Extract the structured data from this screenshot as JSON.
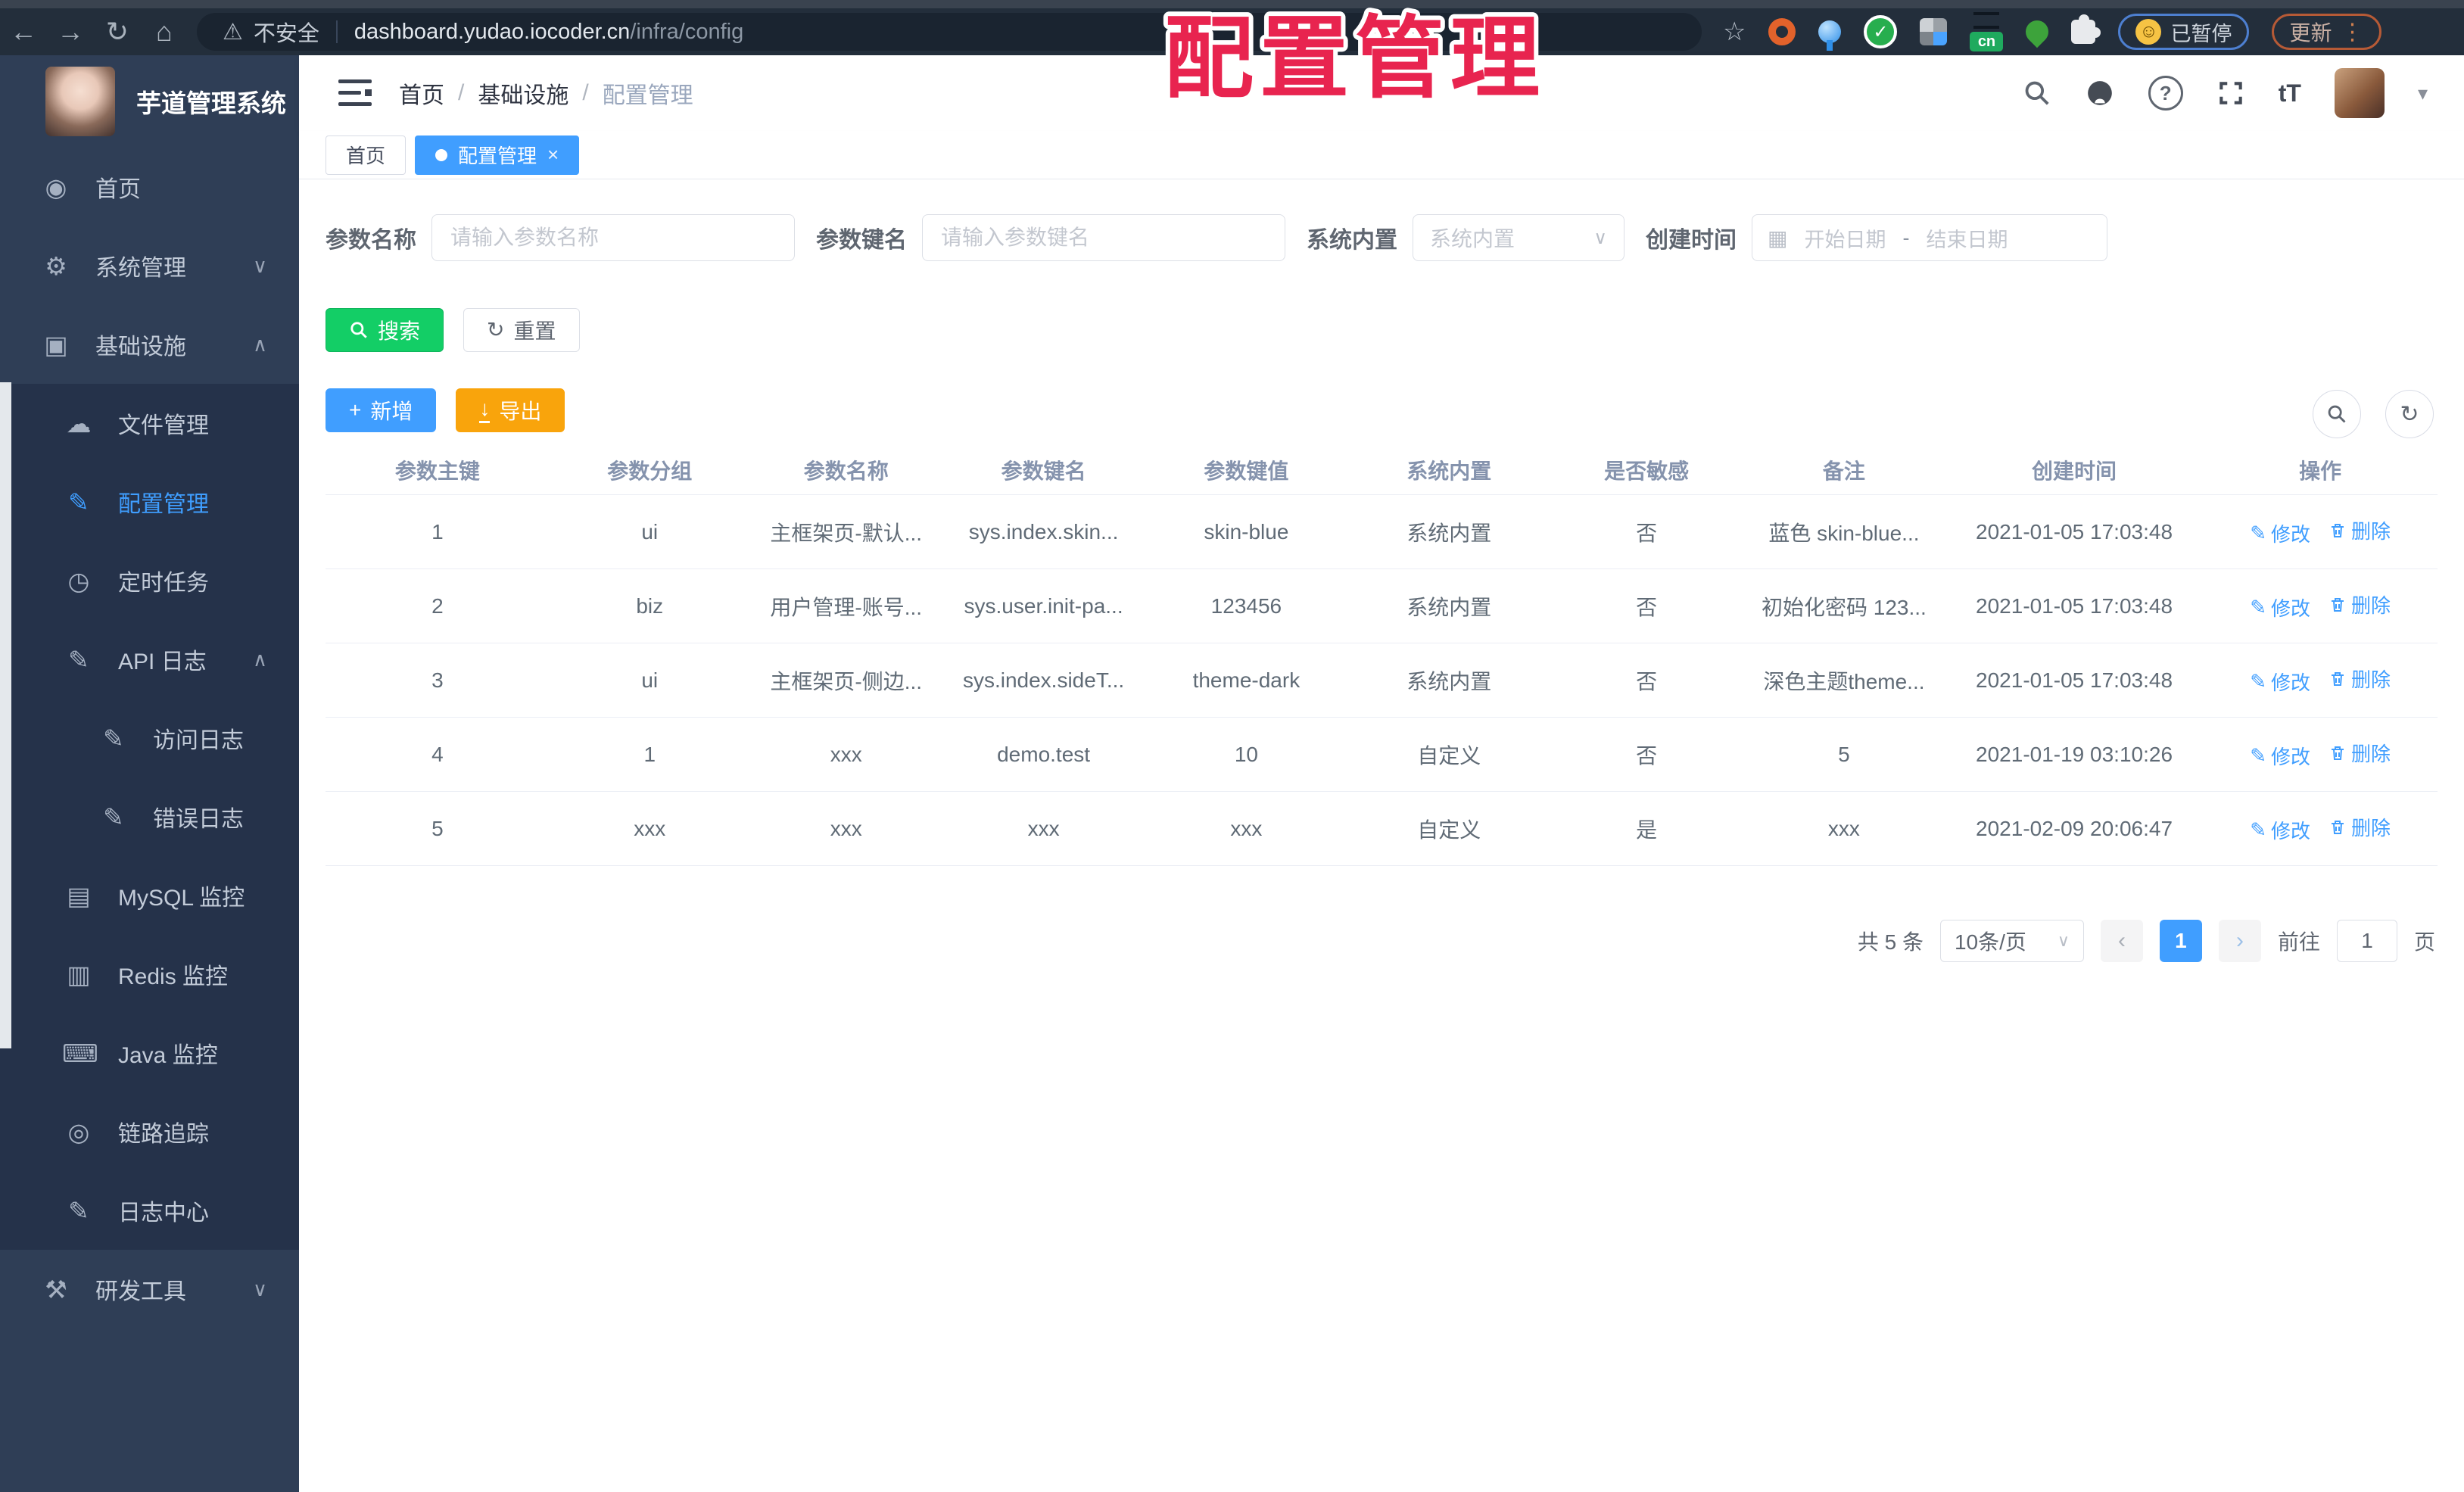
{
  "browser": {
    "security_label": "不安全",
    "url_host": "dashboard.yudao.iocoder.cn",
    "url_path": "/infra/config",
    "paused_badge": "已暂停",
    "update_button": "更新",
    "cn_badge_text": "cn"
  },
  "icons": {
    "back": "←",
    "forward": "→",
    "reload": "↻",
    "home": "⌂",
    "star": "☆",
    "warning": "⚠",
    "dots": "⋮",
    "smiley": "☺",
    "caret_down": "▾",
    "chevron_down": "∨",
    "chevron_up": "∧",
    "calendar": "▦",
    "refresh": "↻",
    "plus": "+",
    "download": "↓",
    "edit": "✎",
    "prev": "‹",
    "next": "›",
    "font_size": "tT",
    "help": "?"
  },
  "overlay": {
    "title": "配置管理",
    "color": "#e8244f"
  },
  "sidebar": {
    "app_title": "芋道管理系统",
    "items": [
      {
        "icon": "◉",
        "label": "首页"
      },
      {
        "icon": "⚙",
        "label": "系统管理",
        "chevron": "∨"
      },
      {
        "icon": "▣",
        "label": "基础设施",
        "chevron": "∧"
      },
      {
        "icon": "☁",
        "label": "文件管理"
      },
      {
        "icon": "✎",
        "label": "配置管理"
      },
      {
        "icon": "◷",
        "label": "定时任务"
      },
      {
        "icon": "✎",
        "label": "API 日志",
        "chevron": "∧"
      },
      {
        "icon": "✎",
        "label": "访问日志"
      },
      {
        "icon": "✎",
        "label": "错误日志"
      },
      {
        "icon": "▤",
        "label": "MySQL 监控"
      },
      {
        "icon": "▥",
        "label": "Redis 监控"
      },
      {
        "icon": "⌨",
        "label": "Java 监控"
      },
      {
        "icon": "◎",
        "label": "链路追踪"
      },
      {
        "icon": "✎",
        "label": "日志中心"
      },
      {
        "icon": "⚒",
        "label": "研发工具",
        "chevron": "∨"
      }
    ]
  },
  "header": {
    "breadcrumb": [
      "首页",
      "基础设施",
      "配置管理"
    ],
    "separator": "/"
  },
  "tabs": [
    {
      "label": "首页"
    },
    {
      "label": "配置管理",
      "close": "×"
    }
  ],
  "filters": {
    "name_label": "参数名称",
    "name_placeholder": "请输入参数名称",
    "key_label": "参数键名",
    "key_placeholder": "请输入参数键名",
    "type_label": "系统内置",
    "type_placeholder": "系统内置",
    "date_label": "创建时间",
    "date_start": "开始日期",
    "date_separator": "-",
    "date_end": "结束日期"
  },
  "toolbar": {
    "search": "搜索",
    "reset": "重置",
    "create": "新增",
    "export": "导出"
  },
  "table": {
    "headers": [
      "参数主键",
      "参数分组",
      "参数名称",
      "参数键名",
      "参数键值",
      "系统内置",
      "是否敏感",
      "备注",
      "创建时间",
      "操作"
    ],
    "edit_label": "修改",
    "delete_label": "删除",
    "rows": [
      {
        "id": "1",
        "group": "ui",
        "name": "主框架页-默认...",
        "key": "sys.index.skin...",
        "value": "skin-blue",
        "builtin": "系统内置",
        "sensitive": "否",
        "remark": "蓝色 skin-blue...",
        "created": "2021-01-05 17:03:48"
      },
      {
        "id": "2",
        "group": "biz",
        "name": "用户管理-账号...",
        "key": "sys.user.init-pa...",
        "value": "123456",
        "builtin": "系统内置",
        "sensitive": "否",
        "remark": "初始化密码 123...",
        "created": "2021-01-05 17:03:48"
      },
      {
        "id": "3",
        "group": "ui",
        "name": "主框架页-侧边...",
        "key": "sys.index.sideT...",
        "value": "theme-dark",
        "builtin": "系统内置",
        "sensitive": "否",
        "remark": "深色主题theme...",
        "created": "2021-01-05 17:03:48"
      },
      {
        "id": "4",
        "group": "1",
        "name": "xxx",
        "key": "demo.test",
        "value": "10",
        "builtin": "自定义",
        "sensitive": "否",
        "remark": "5",
        "created": "2021-01-19 03:10:26"
      },
      {
        "id": "5",
        "group": "xxx",
        "name": "xxx",
        "key": "xxx",
        "value": "xxx",
        "builtin": "自定义",
        "sensitive": "是",
        "remark": "xxx",
        "created": "2021-02-09 20:06:47"
      }
    ]
  },
  "pagination": {
    "total": "共 5 条",
    "page_size": "10条/页",
    "current": "1",
    "goto_label": "前往",
    "goto_value": "1",
    "page_unit": "页"
  },
  "colors": {
    "accent": "#409eff",
    "success": "#13ce66",
    "warning": "#f9a40c",
    "overlay_red": "#e8244f"
  }
}
